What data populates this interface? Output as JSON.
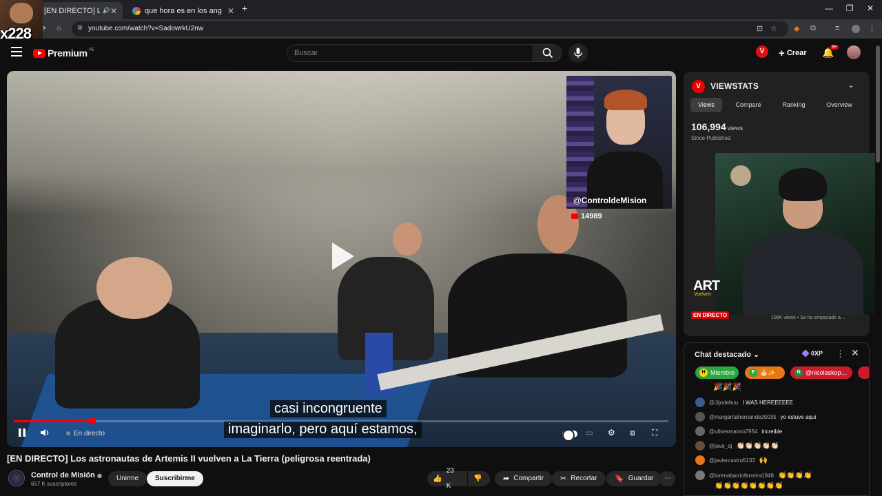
{
  "browser": {
    "tabs": [
      {
        "label": "[EN DIRECTO] Los astron…",
        "active": true
      },
      {
        "label": "que hora es en los angeles - Bu",
        "active": false
      }
    ],
    "url": "youtube.com/watch?v=SadowrkU2nw",
    "new_tab": "+",
    "window": {
      "minimize": "—",
      "maximize": "❐",
      "close": "✕"
    }
  },
  "overlay": {
    "streamer_tag": "x228"
  },
  "header": {
    "brand": "Premium",
    "brand_sup": "PE",
    "search_placeholder": "Buscar",
    "create_label": "Crear",
    "notification_count": "9+",
    "viewstats_letter": "V"
  },
  "video": {
    "pip_handle": "@ControldeMision",
    "pip_count": "14989",
    "subtitle_line1": "casi incongruente",
    "subtitle_line2": "imaginarlo, pero aquí estamos,",
    "live_label": "En directo",
    "progress": 0.12
  },
  "meta": {
    "title": "[EN DIRECTO] Los astronautas de Artemis II vuelven a La Tierra (peligrosa reentrada)",
    "channel": "Control de Misión",
    "subscribers": "657 K suscriptores",
    "join_label": "Unirme",
    "subscribe_label": "Suscribirme",
    "likes": "23 K",
    "share_label": "Compartir",
    "clip_label": "Recortar",
    "save_label": "Guardar"
  },
  "viewstats": {
    "title": "VIEWSTATS",
    "tabs": [
      "Views",
      "Compare",
      "Ranking",
      "Overview"
    ],
    "views_number": "106,994",
    "views_unit": "views",
    "since": "Since Published",
    "art_logo": "ART",
    "art_sub": "Vuelven",
    "en_directo": "EN DIRECTO",
    "recommended_meta": "106K views • Se ha empezado a…"
  },
  "chat": {
    "title": "Chat destacado",
    "xp": "0XP",
    "chips": [
      {
        "letter": "H",
        "label": "Miembro",
        "color": "#2ba640",
        "badge": "#ffd400"
      },
      {
        "letter": "E",
        "label": "",
        "color": "#e8771c",
        "badge": "#2ba640"
      },
      {
        "letter": "N",
        "label": "@nicolaskop…",
        "color": "#cc1c2b",
        "badge": "#1f8b3a"
      }
    ],
    "top_emojis": "🎉🎉🎉",
    "messages": [
      {
        "user": "@Jijodebuu",
        "text": "I WAS HEREEEEEE",
        "avatar": "#3a5d8c"
      },
      {
        "user": "@margaritahernandez5035",
        "text": "yo estuve aqui",
        "avatar": "#555"
      },
      {
        "user": "@ulisesmaimo7954",
        "text": "increible",
        "avatar": "#666"
      },
      {
        "user": "@jave_dj",
        "text": "👏🏻👏🏻👏🏻👏🏻👏🏻",
        "avatar": "#6b4a3a"
      },
      {
        "user": "@javiercastro5133",
        "text": "🙌",
        "avatar": "#e8771c"
      },
      {
        "user": "@lorenabarrioferreira1948",
        "text": "👏👏👏👏",
        "avatar": "#777"
      }
    ],
    "last_emojis": "👏👏👏👏👏👏👏👏"
  }
}
